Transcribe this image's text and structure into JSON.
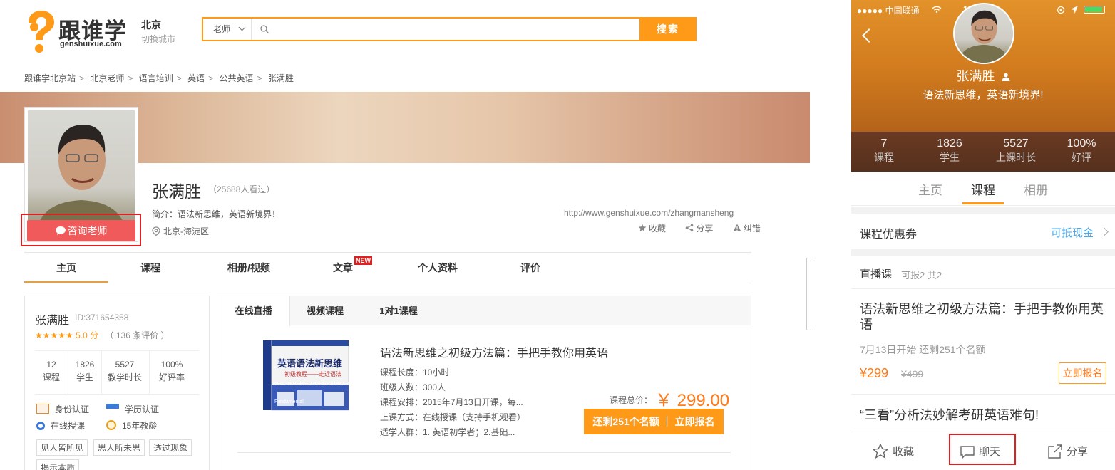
{
  "desktop": {
    "logo": {
      "text": "跟谁学",
      "domain": "genshuixue.com"
    },
    "city": {
      "name": "北京",
      "switch_label": "切换城市"
    },
    "search": {
      "category": "老师",
      "placeholder": "",
      "button": "搜索"
    },
    "breadcrumb": [
      "跟谁学北京站",
      "北京老师",
      "语言培训",
      "英语",
      "公共英语",
      "张满胜"
    ],
    "breadcrumb_sep": ">",
    "teacher": {
      "name": "张满胜",
      "views": "（25688人看过）",
      "intro": "简介：语法新思维，英语新境界！",
      "location": "北京-海淀区",
      "url": "http://www.genshuixue.com/zhangmansheng",
      "consult_button": "咨询老师"
    },
    "actions": {
      "favorite": "收藏",
      "share": "分享",
      "report": "纠错"
    },
    "main_tabs": [
      {
        "label": "主页",
        "active": true
      },
      {
        "label": "课程"
      },
      {
        "label": "相册/视频"
      },
      {
        "label": "文章"
      },
      {
        "label": "个人资料"
      },
      {
        "label": "评价"
      }
    ],
    "new_badge": "NEW",
    "info_card": {
      "name": "张满胜",
      "id": "ID:371654358",
      "stars": "★★★★★",
      "score": "5.0 分",
      "reviews": "（ 136 条评价 ）",
      "rating": 5.0,
      "stats": [
        {
          "value": "12",
          "label": "课程"
        },
        {
          "value": "1826",
          "label": "学生"
        },
        {
          "value": "5527",
          "label": "教学时长"
        },
        {
          "value": "100%",
          "label": "好评率"
        }
      ],
      "certs": [
        "身份认证",
        "学历认证",
        "在线授课",
        "15年教龄"
      ],
      "tags": [
        "见人皆所见",
        "思人所未思",
        "透过现象",
        "揭示本质"
      ]
    },
    "course_tabs": [
      {
        "label": "在线直播",
        "active": true
      },
      {
        "label": "视频课程"
      },
      {
        "label": "1对1课程"
      }
    ],
    "course": {
      "book_title": "英语语法新思维",
      "book_subtitle": "初级教程——走近语法",
      "book_en": "NEW PERSPECTIVE GRAMMAR",
      "book_en2": "Fundamental",
      "title": "语法新思维之初级方法篇：手把手教你用英语",
      "meta": [
        "课程长度：10小时",
        "班级人数：300人",
        "课程安排：2015年7月13日开课，每...",
        "上课方式：在线授课（支持手机观看）",
        "适学人群：1. 英语初学者；2.基础..."
      ],
      "price_label": "课程总价：",
      "price": "￥ 299.00",
      "enroll": "还剩251个名额 ｜ 立即报名"
    }
  },
  "mobile": {
    "status": {
      "carrier": "●●●●● 中国联通",
      "time": "15:19"
    },
    "name": "张满胜",
    "slogan": "语法新思维，英语新境界!",
    "stats": [
      {
        "value": "7",
        "label": "课程"
      },
      {
        "value": "1826",
        "label": "学生"
      },
      {
        "value": "5527",
        "label": "上课时长"
      },
      {
        "value": "100%",
        "label": "好评"
      }
    ],
    "tabs": [
      {
        "label": "主页"
      },
      {
        "label": "课程",
        "active": true
      },
      {
        "label": "相册"
      }
    ],
    "coupon": {
      "label": "课程优惠券",
      "right": "可抵现金"
    },
    "live": {
      "label": "直播课",
      "sub": "可报2 共2"
    },
    "course1": {
      "title": "语法新思维之初级方法篇：手把手教你用英语",
      "sub": "7月13日开始  还剩251个名额",
      "price": "¥299",
      "old_price": "¥499",
      "enroll": "立即报名"
    },
    "course2": {
      "title": "“三看”分析法妙解考研英语难句!"
    },
    "bottom": {
      "favorite": "收藏",
      "chat": "聊天",
      "share": "分享"
    }
  },
  "colors": {
    "accent": "#ff9a18",
    "red": "#f05a5a",
    "highlight": "#e02020",
    "link": "#4aa8e8"
  }
}
